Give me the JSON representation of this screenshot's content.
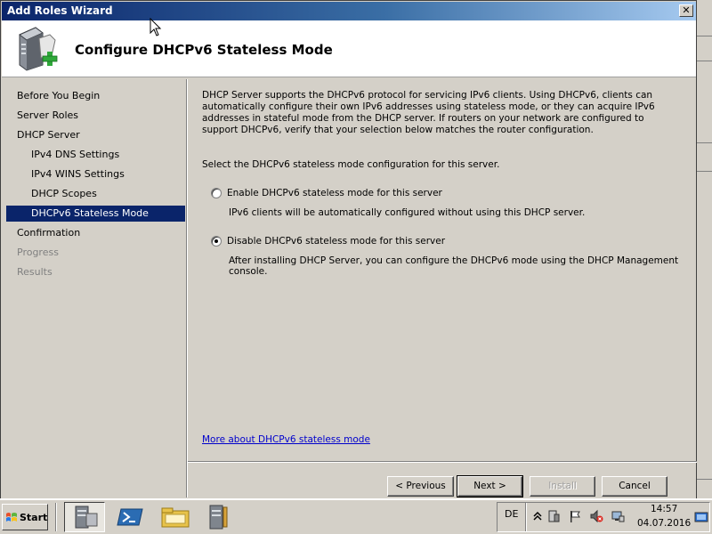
{
  "window": {
    "title": "Add Roles Wizard",
    "close_label": "✕"
  },
  "header": {
    "title": "Configure DHCPv6 Stateless Mode"
  },
  "nav": {
    "items": [
      {
        "label": "Before You Begin",
        "level": 0,
        "state": "normal"
      },
      {
        "label": "Server Roles",
        "level": 0,
        "state": "normal"
      },
      {
        "label": "DHCP Server",
        "level": 0,
        "state": "normal"
      },
      {
        "label": "IPv4 DNS Settings",
        "level": 1,
        "state": "normal"
      },
      {
        "label": "IPv4 WINS Settings",
        "level": 1,
        "state": "normal"
      },
      {
        "label": "DHCP Scopes",
        "level": 1,
        "state": "normal"
      },
      {
        "label": "DHCPv6 Stateless Mode",
        "level": 1,
        "state": "active"
      },
      {
        "label": "Confirmation",
        "level": 0,
        "state": "normal"
      },
      {
        "label": "Progress",
        "level": 0,
        "state": "disabled"
      },
      {
        "label": "Results",
        "level": 0,
        "state": "disabled"
      }
    ]
  },
  "main": {
    "description": "DHCP Server supports the DHCPv6 protocol for servicing IPv6 clients. Using DHCPv6, clients can automatically configure their own IPv6 addresses using stateless mode, or they can acquire IPv6 addresses in stateful mode from the DHCP server. If routers on your network are configured to support DHCPv6, verify that your selection below matches the router configuration.",
    "select_label": "Select the DHCPv6 stateless mode configuration for this server.",
    "options": [
      {
        "label": "Enable DHCPv6 stateless mode for this server",
        "description": "IPv6 clients will be automatically configured without using this DHCP server.",
        "checked": false
      },
      {
        "label": "Disable DHCPv6 stateless mode for this server",
        "description": "After installing DHCP Server, you can configure the DHCPv6 mode using the DHCP Management console.",
        "checked": true
      }
    ],
    "link": "More about DHCPv6 stateless mode"
  },
  "buttons": {
    "previous": "< Previous",
    "next": "Next >",
    "install": "Install",
    "cancel": "Cancel"
  },
  "taskbar": {
    "start_label": "Start",
    "language": "DE",
    "time": "14:57",
    "date": "04.07.2016",
    "apps": [
      "server-manager-icon",
      "powershell-icon",
      "explorer-icon",
      "tools-icon"
    ]
  }
}
